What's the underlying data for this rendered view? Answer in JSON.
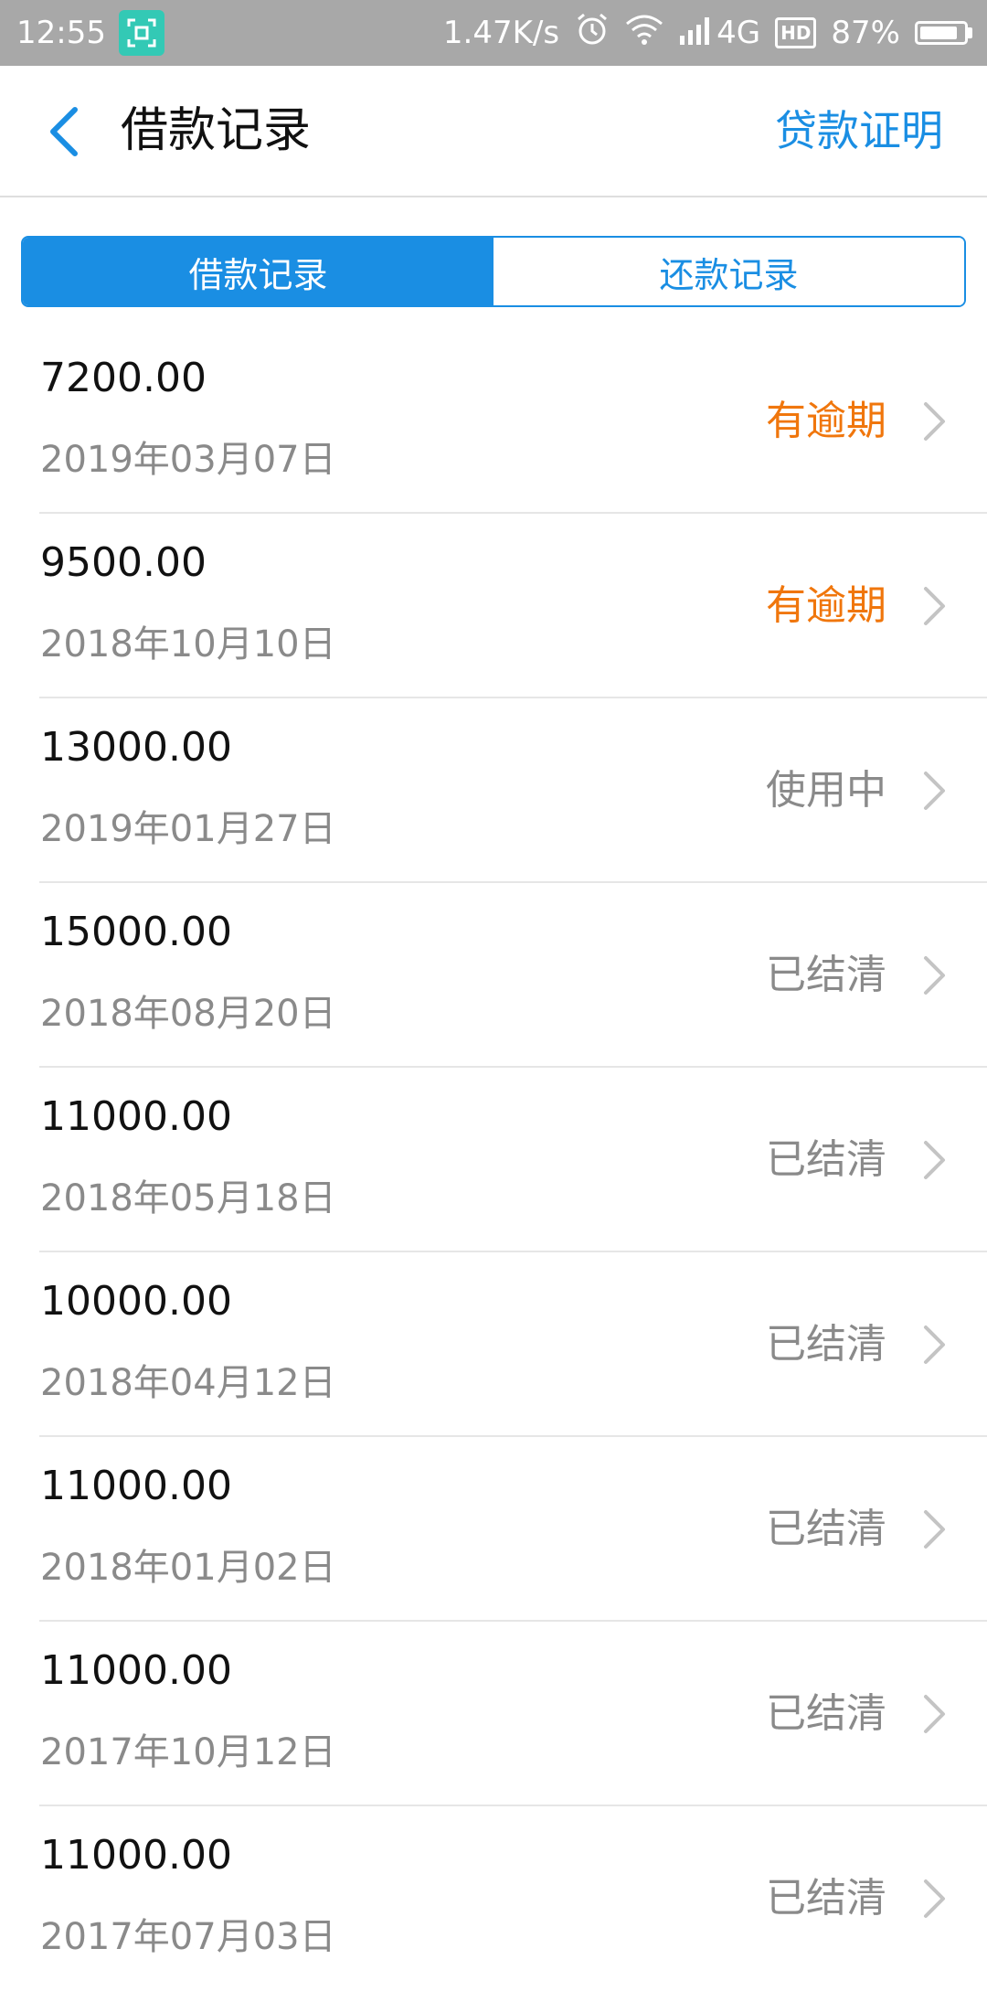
{
  "status_bar": {
    "time": "12:55",
    "net_speed": "1.47K/s",
    "network": "4G",
    "hd": "HD",
    "battery_text": "87%",
    "battery_level": 0.87,
    "icons": [
      "screenshot-app-icon",
      "alarm-icon",
      "wifi-icon",
      "signal-icon",
      "hd-icon",
      "battery-icon"
    ]
  },
  "header": {
    "back_icon": "chevron-left-icon",
    "title": "借款记录",
    "action_label": "贷款证明"
  },
  "tabs": [
    {
      "label": "借款记录",
      "selected": true
    },
    {
      "label": "还款记录",
      "selected": false
    }
  ],
  "records": [
    {
      "amount": "7200.00",
      "date": "2019年03月07日",
      "status": "有逾期",
      "status_type": "overdue"
    },
    {
      "amount": "9500.00",
      "date": "2018年10月10日",
      "status": "有逾期",
      "status_type": "overdue"
    },
    {
      "amount": "13000.00",
      "date": "2019年01月27日",
      "status": "使用中",
      "status_type": "in-use"
    },
    {
      "amount": "15000.00",
      "date": "2018年08月20日",
      "status": "已结清",
      "status_type": "settled"
    },
    {
      "amount": "11000.00",
      "date": "2018年05月18日",
      "status": "已结清",
      "status_type": "settled"
    },
    {
      "amount": "10000.00",
      "date": "2018年04月12日",
      "status": "已结清",
      "status_type": "settled"
    },
    {
      "amount": "11000.00",
      "date": "2018年01月02日",
      "status": "已结清",
      "status_type": "settled"
    },
    {
      "amount": "11000.00",
      "date": "2017年10月12日",
      "status": "已结清",
      "status_type": "settled"
    },
    {
      "amount": "11000.00",
      "date": "2017年07月03日",
      "status": "已结清",
      "status_type": "settled"
    }
  ],
  "colors": {
    "accent": "#1a8ee3",
    "overdue": "#f0760c",
    "muted": "#8a8a8a",
    "status_bar": "#a8a8a8"
  }
}
